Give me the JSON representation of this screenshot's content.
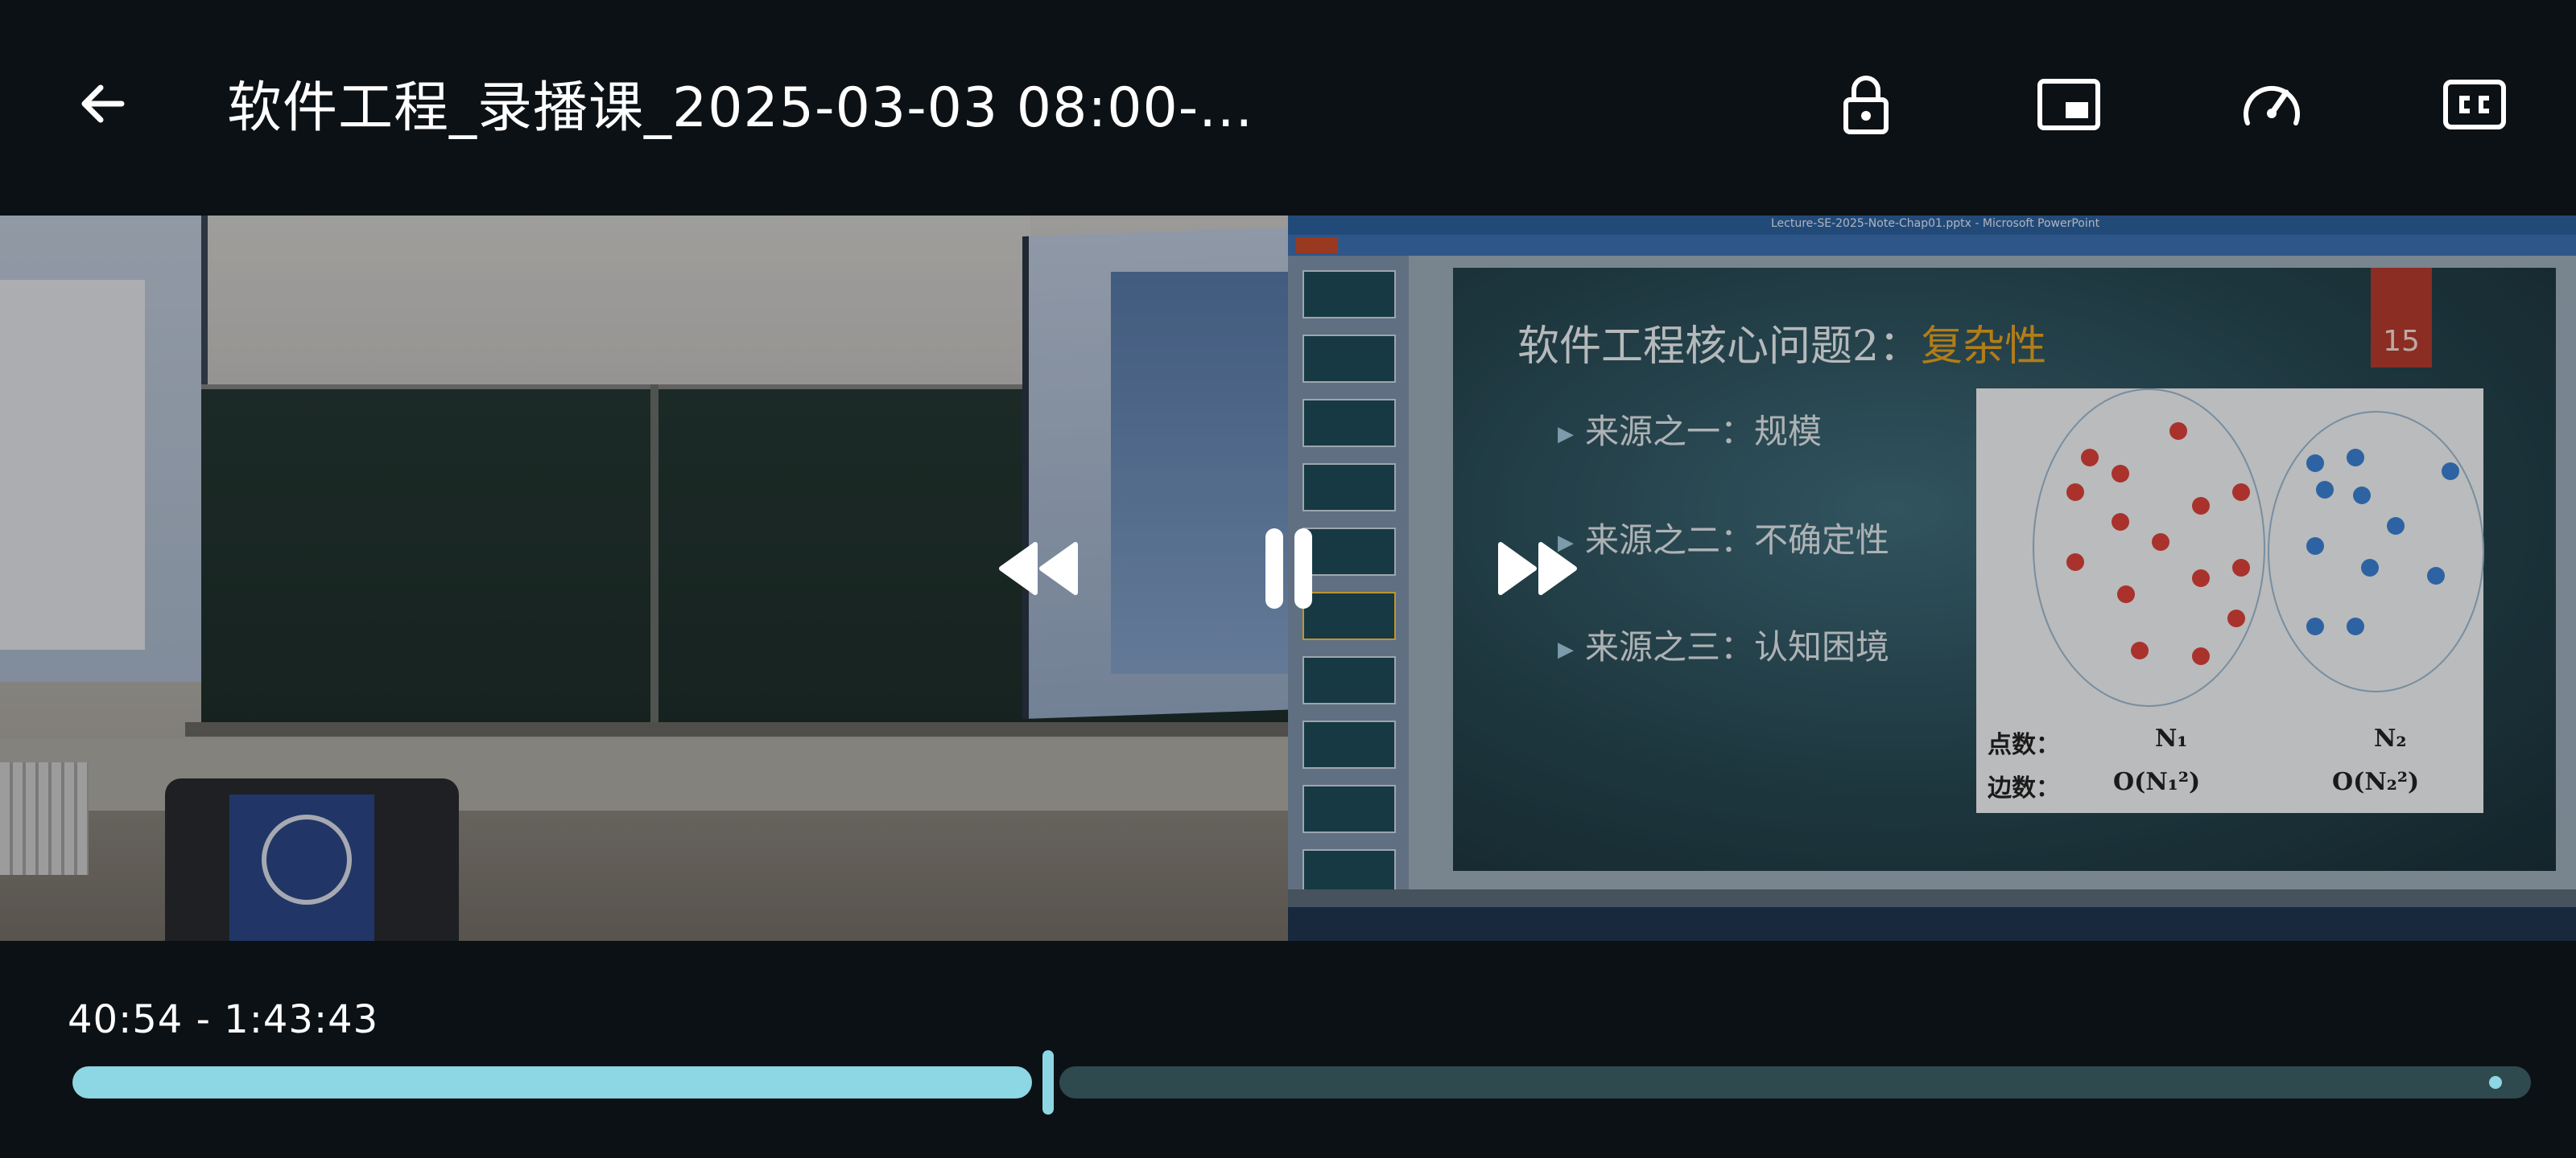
{
  "header": {
    "title": "软件工程_录播课_2025-03-03 08:00-...",
    "icons": [
      "back-arrow-icon",
      "lock-icon",
      "picture-in-picture-icon",
      "speed-gauge-icon",
      "closed-captions-icon"
    ]
  },
  "slide": {
    "title_prefix": "软件工程核心问题2：",
    "title_highlight": "复杂性",
    "number": "15",
    "bullets": [
      "来源之一：规模",
      "来源之二：不确定性",
      "来源之三：认知困境"
    ],
    "diagram": {
      "row1_label": "点数：",
      "row2_label": "边数：",
      "n1": "N₁",
      "n2": "N₂",
      "o1": "O(N₁²)",
      "o2": "O(N₂²)"
    }
  },
  "ppt_window_title": "Lecture-SE-2025-Note-Chap01.pptx - Microsoft PowerPoint",
  "player": {
    "time_text": "40:54 - 1:43:43",
    "progress_fraction": 0.394,
    "controls": [
      "rewind-icon",
      "pause-icon",
      "fast-forward-icon"
    ]
  },
  "colors": {
    "progress_fill": "#8dd6e4",
    "progress_track": "#2e4a4f",
    "slide_number_bg": "#b23a2c",
    "title_highlight": "#e5a11f"
  }
}
